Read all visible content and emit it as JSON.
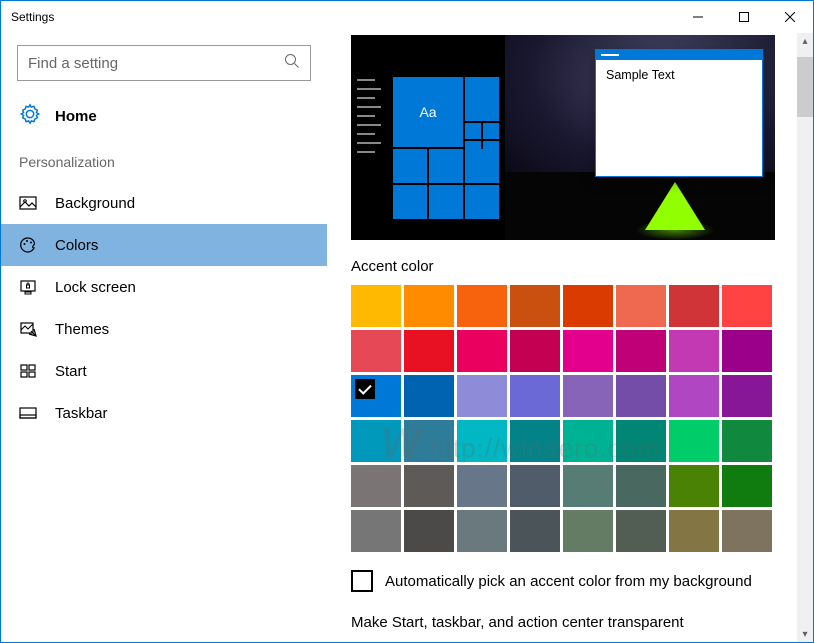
{
  "window": {
    "title": "Settings"
  },
  "sidebar": {
    "search_placeholder": "Find a setting",
    "home_label": "Home",
    "section_label": "Personalization",
    "items": [
      {
        "label": "Background"
      },
      {
        "label": "Colors"
      },
      {
        "label": "Lock screen"
      },
      {
        "label": "Themes"
      },
      {
        "label": "Start"
      },
      {
        "label": "Taskbar"
      }
    ]
  },
  "preview": {
    "tile_text": "Aa",
    "sample_window_text": "Sample Text"
  },
  "accent": {
    "heading": "Accent color",
    "auto_pick_label": "Automatically pick an accent color from my background",
    "selected_index": 16,
    "swatches": [
      "#ffb900",
      "#ff8c00",
      "#f7630c",
      "#ca5010",
      "#da3b01",
      "#ef6950",
      "#d13438",
      "#ff4343",
      "#e74856",
      "#e81123",
      "#ea005e",
      "#c30052",
      "#e3008c",
      "#bf0077",
      "#c239b3",
      "#9a0089",
      "#0078d7",
      "#0063b1",
      "#8e8cd8",
      "#6b69d6",
      "#8764b8",
      "#744da9",
      "#b146c2",
      "#881798",
      "#0099bc",
      "#2d7d9a",
      "#00b7c3",
      "#038387",
      "#00b294",
      "#018574",
      "#00cc6a",
      "#10893e",
      "#7a7574",
      "#5d5a58",
      "#68768a",
      "#515c6b",
      "#567c73",
      "#486860",
      "#498205",
      "#107c10",
      "#767676",
      "#4c4a48",
      "#69797e",
      "#4a5459",
      "#647c64",
      "#525e54",
      "#847545",
      "#7e735f"
    ]
  },
  "transparency": {
    "heading_truncated": "Make Start, taskbar, and action center transparent"
  },
  "watermark": "http://winaero.com"
}
